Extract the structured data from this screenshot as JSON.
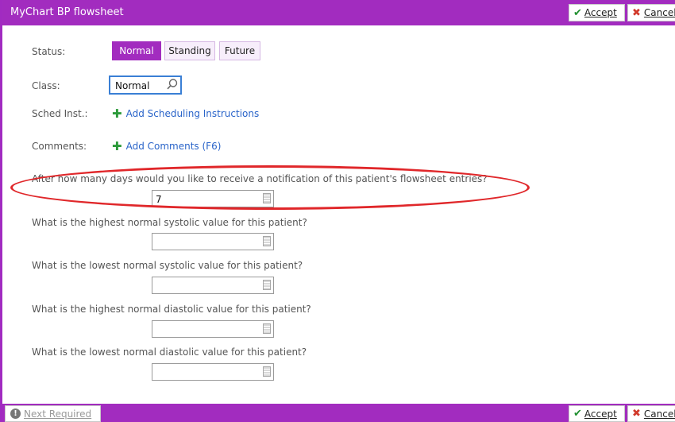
{
  "window": {
    "title": "MyChart BP flowsheet",
    "accept_label": "Accept",
    "cancel_label": "Cancel"
  },
  "status": {
    "label": "Status:",
    "options": [
      "Normal",
      "Standing",
      "Future"
    ],
    "selected": "Normal"
  },
  "class": {
    "label": "Class:",
    "value": "Normal"
  },
  "sched": {
    "label": "Sched Inst.:",
    "link": "Add Scheduling Instructions"
  },
  "comments": {
    "label": "Comments:",
    "link": "Add Comments (F6)"
  },
  "questions": [
    {
      "text": "After how many days would you like to receive a notification of this patient's flowsheet entries?",
      "value": "7"
    },
    {
      "text": "What is the highest normal systolic value for this patient?",
      "value": ""
    },
    {
      "text": "What is the lowest normal systolic value for this patient?",
      "value": ""
    },
    {
      "text": "What is the highest normal diastolic value for this patient?",
      "value": ""
    },
    {
      "text": "What is the lowest normal diastolic value for this patient?",
      "value": ""
    }
  ],
  "footer": {
    "next_required_label": "Next Required",
    "accept_label": "Accept",
    "cancel_label": "Cancel"
  },
  "colors": {
    "accent": "#a22cbf",
    "link": "#2a64c9",
    "annotation": "#e0272a"
  },
  "icons": [
    "check-icon",
    "x-icon",
    "search-icon",
    "plus-icon",
    "calculator-icon",
    "info-icon"
  ]
}
